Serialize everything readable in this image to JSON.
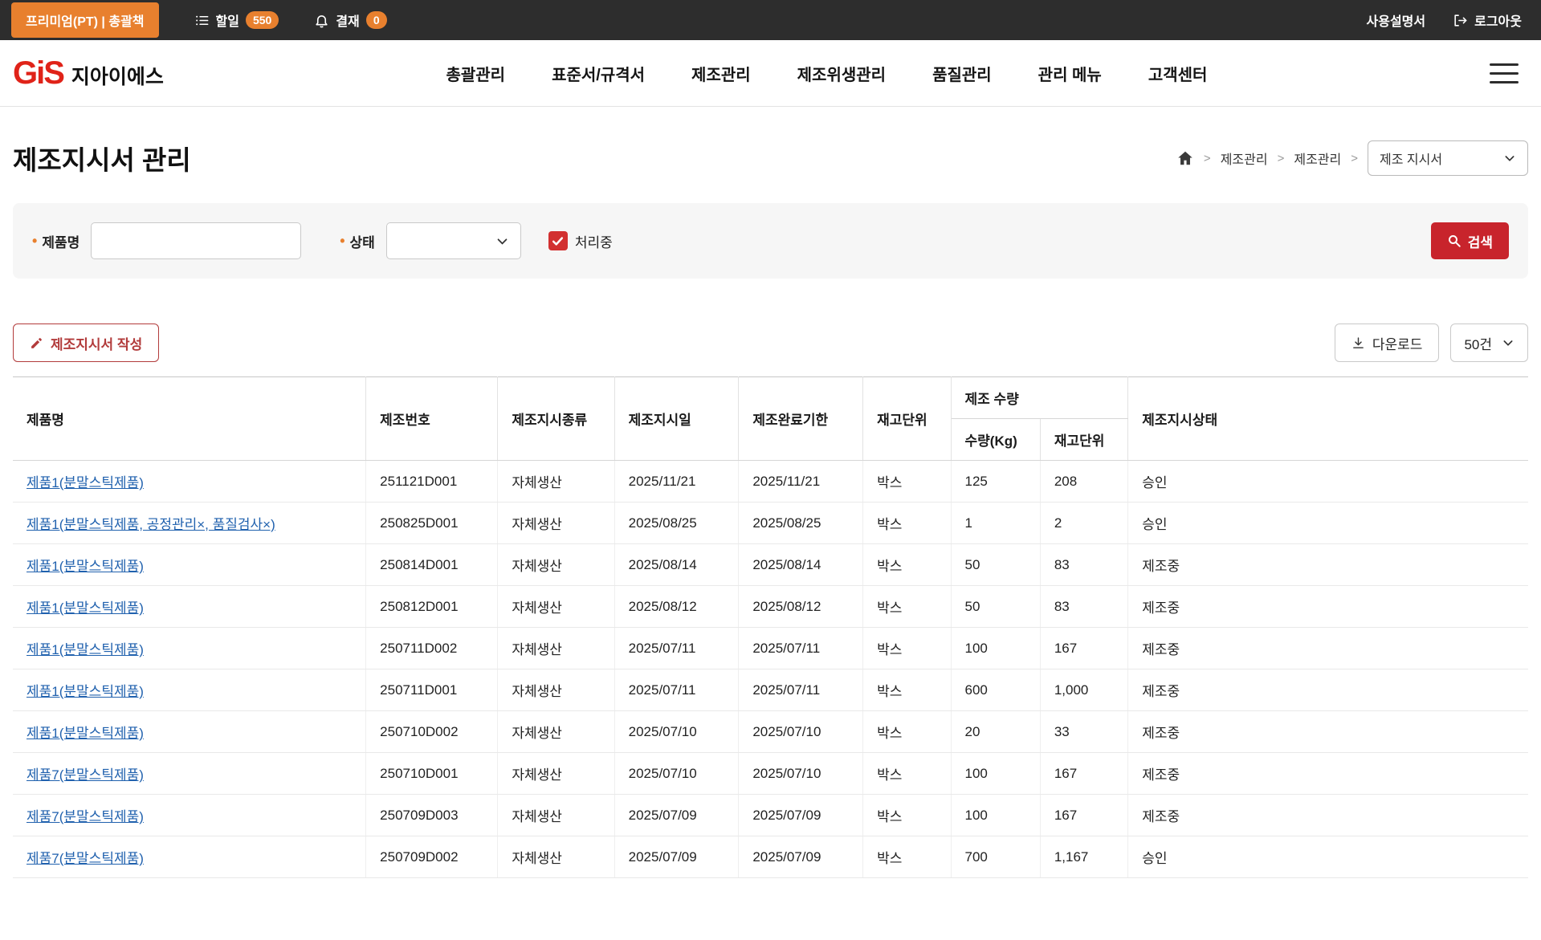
{
  "topbar": {
    "premium_badge": "프리미엄(PT) | 총괄책",
    "todo_label": "할일",
    "todo_count": "550",
    "approval_label": "결재",
    "approval_count": "0",
    "manual_link": "사용설명서",
    "logout_link": "로그아웃"
  },
  "header": {
    "logo_mark": "GiS",
    "logo_name": "지아이에스",
    "nav": {
      "item1": "총괄관리",
      "item2": "표준서/규격서",
      "item3": "제조관리",
      "item4": "제조위생관리",
      "item5": "품질관리",
      "item6": "관리 메뉴",
      "item7": "고객센터"
    }
  },
  "page": {
    "title": "제조지시서 관리",
    "breadcrumb1": "제조관리",
    "breadcrumb2": "제조관리",
    "breadcrumb_select": "제조 지시서"
  },
  "filters": {
    "product_label": "제품명",
    "status_label": "상태",
    "processing_label": "처리중",
    "search_button": "검색"
  },
  "toolbar": {
    "create_button": "제조지시서 작성",
    "download_button": "다운로드",
    "page_size": "50건"
  },
  "table": {
    "headers": {
      "product": "제품명",
      "order_no": "제조번호",
      "order_type": "제조지시종류",
      "order_date": "제조지시일",
      "due_date": "제조완료기한",
      "stock_unit": "재고단위",
      "qty_group": "제조 수량",
      "qty_kg": "수량(Kg)",
      "qty_unit": "재고단위",
      "status": "제조지시상태"
    },
    "rows": [
      {
        "product": "제품1(분말스틱제품)",
        "order_no": "251121D001",
        "order_type": "자체생산",
        "order_date": "2025/11/21",
        "due_date": "2025/11/21",
        "stock_unit": "박스",
        "qty_kg": "125",
        "qty_unit": "208",
        "status": "승인"
      },
      {
        "product": "제품1(분말스틱제품, 공정관리×, 품질검사×)",
        "order_no": "250825D001",
        "order_type": "자체생산",
        "order_date": "2025/08/25",
        "due_date": "2025/08/25",
        "stock_unit": "박스",
        "qty_kg": "1",
        "qty_unit": "2",
        "status": "승인"
      },
      {
        "product": "제품1(분말스틱제품)",
        "order_no": "250814D001",
        "order_type": "자체생산",
        "order_date": "2025/08/14",
        "due_date": "2025/08/14",
        "stock_unit": "박스",
        "qty_kg": "50",
        "qty_unit": "83",
        "status": "제조중"
      },
      {
        "product": "제품1(분말스틱제품)",
        "order_no": "250812D001",
        "order_type": "자체생산",
        "order_date": "2025/08/12",
        "due_date": "2025/08/12",
        "stock_unit": "박스",
        "qty_kg": "50",
        "qty_unit": "83",
        "status": "제조중"
      },
      {
        "product": "제품1(분말스틱제품)",
        "order_no": "250711D002",
        "order_type": "자체생산",
        "order_date": "2025/07/11",
        "due_date": "2025/07/11",
        "stock_unit": "박스",
        "qty_kg": "100",
        "qty_unit": "167",
        "status": "제조중"
      },
      {
        "product": "제품1(분말스틱제품)",
        "order_no": "250711D001",
        "order_type": "자체생산",
        "order_date": "2025/07/11",
        "due_date": "2025/07/11",
        "stock_unit": "박스",
        "qty_kg": "600",
        "qty_unit": "1,000",
        "status": "제조중"
      },
      {
        "product": "제품1(분말스틱제품)",
        "order_no": "250710D002",
        "order_type": "자체생산",
        "order_date": "2025/07/10",
        "due_date": "2025/07/10",
        "stock_unit": "박스",
        "qty_kg": "20",
        "qty_unit": "33",
        "status": "제조중"
      },
      {
        "product": "제품7(분말스틱제품)",
        "order_no": "250710D001",
        "order_type": "자체생산",
        "order_date": "2025/07/10",
        "due_date": "2025/07/10",
        "stock_unit": "박스",
        "qty_kg": "100",
        "qty_unit": "167",
        "status": "제조중"
      },
      {
        "product": "제품7(분말스틱제품)",
        "order_no": "250709D003",
        "order_type": "자체생산",
        "order_date": "2025/07/09",
        "due_date": "2025/07/09",
        "stock_unit": "박스",
        "qty_kg": "100",
        "qty_unit": "167",
        "status": "제조중"
      },
      {
        "product": "제품7(분말스틱제품)",
        "order_no": "250709D002",
        "order_type": "자체생산",
        "order_date": "2025/07/09",
        "due_date": "2025/07/09",
        "stock_unit": "박스",
        "qty_kg": "700",
        "qty_unit": "1,167",
        "status": "승인"
      }
    ]
  }
}
